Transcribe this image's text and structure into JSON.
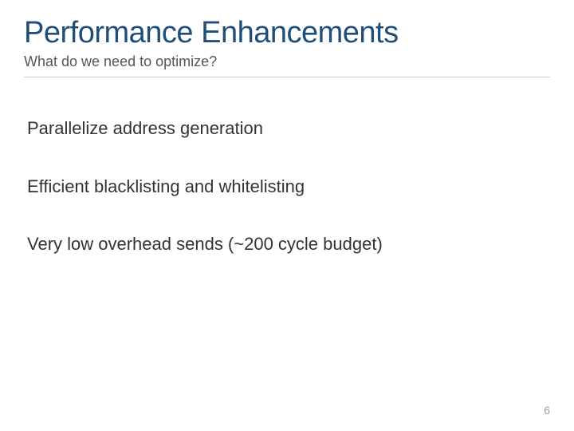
{
  "slide": {
    "title": "Performance Enhancements",
    "subtitle": "What do we need to optimize?",
    "bullets": [
      "Parallelize address generation",
      "Efficient blacklisting and whitelisting",
      "Very low overhead sends (~200 cycle budget)"
    ],
    "page_number": "6"
  }
}
